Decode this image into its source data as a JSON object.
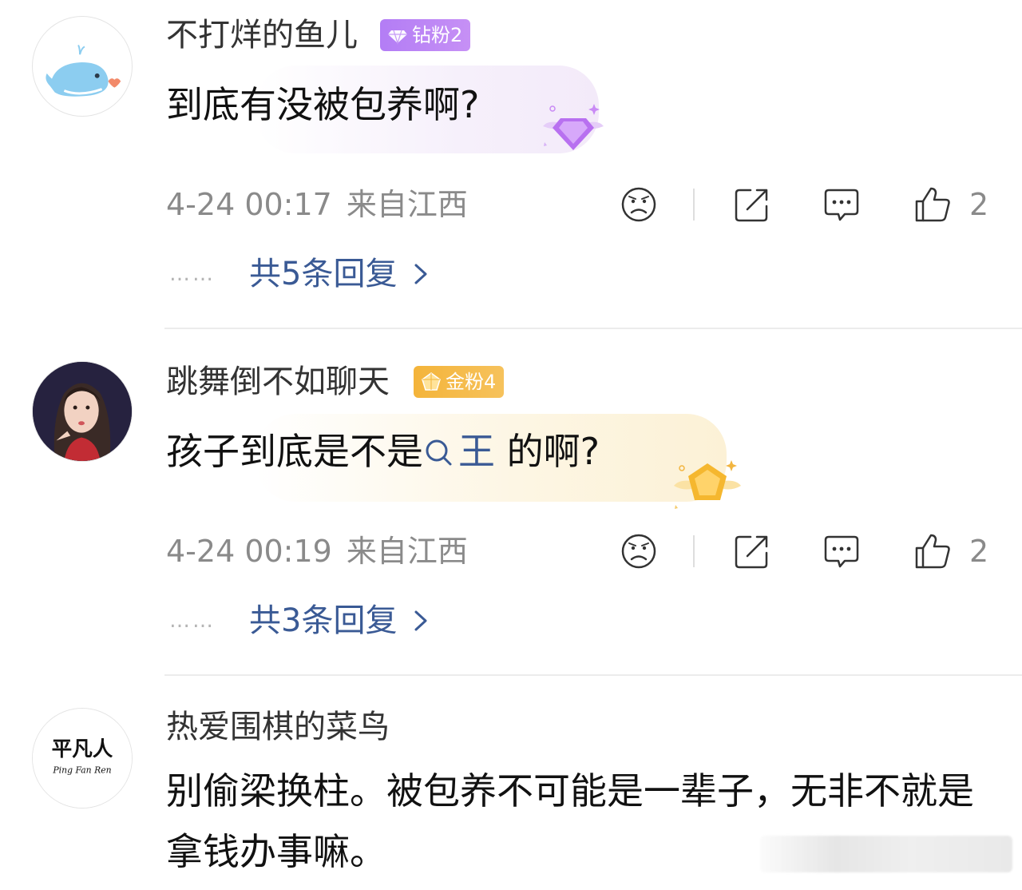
{
  "comments": [
    {
      "username": "不打烊的鱼儿",
      "badge": {
        "label": "钻粉2",
        "type": "diamond",
        "color": "#b57ff5"
      },
      "avatar_icon": "whale-icon",
      "text": "到底有没被包养啊?",
      "date": "4-24 00:17",
      "location": "来自江西",
      "likes": "2",
      "replies_label": "共5条回复",
      "replies_dots": "……"
    },
    {
      "username": "跳舞倒不如聊天",
      "badge": {
        "label": "金粉4",
        "type": "gold",
        "color": "#f4b43a"
      },
      "avatar_icon": "user-photo-icon",
      "text_before": "孩子到底是不是",
      "mention": "王",
      "text_after": " 的啊?",
      "date": "4-24 00:19",
      "location": "来自江西",
      "likes": "2",
      "replies_label": "共3条回复",
      "replies_dots": "……"
    },
    {
      "username": "热爱围棋的菜鸟",
      "avatar_logo_text": "平凡人",
      "avatar_logo_sub": "Ping Fan Ren",
      "text": "别偷梁换柱。被包养不可能是一辈子，无非不就是拿钱办事嘛。"
    }
  ],
  "icons": {
    "angry": "angry-face-icon",
    "share": "share-icon",
    "reply": "comment-bubble-icon",
    "like": "thumbs-up-icon",
    "chevron": "chevron-right-icon",
    "search": "search-icon"
  },
  "colors": {
    "link": "#3a5a95",
    "meta": "#8a8a8a",
    "username": "#333333"
  }
}
